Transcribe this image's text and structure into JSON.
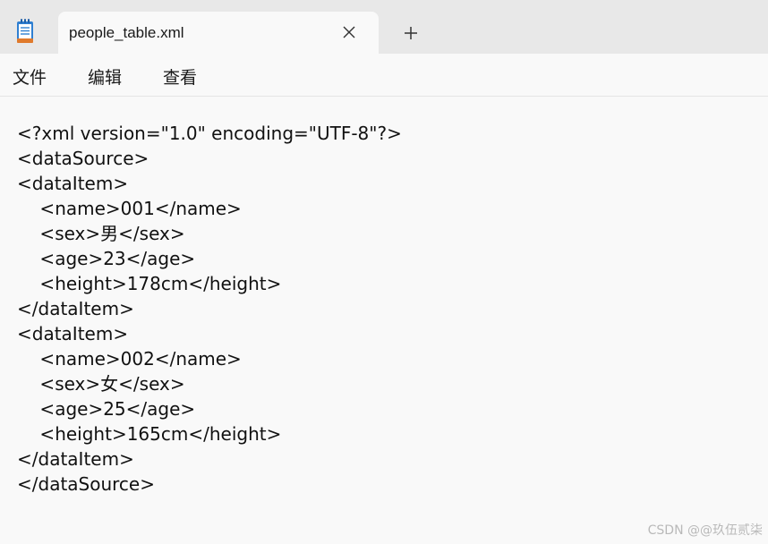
{
  "tab": {
    "title": "people_table.xml"
  },
  "menu": [
    {
      "label": "文件"
    },
    {
      "label": "编辑"
    },
    {
      "label": "查看"
    }
  ],
  "editor": {
    "lines": [
      "<?xml version=\"1.0\" encoding=\"UTF-8\"?>",
      "<dataSource>",
      "<dataItem>",
      "    <name>001</name>",
      "    <sex>男</sex>",
      "    <age>23</age>",
      "    <height>178cm</height>",
      "</dataItem>",
      "<dataItem>",
      "    <name>002</name>",
      "    <sex>女</sex>",
      "    <age>25</age>",
      "    <height>165cm</height>",
      "</dataItem>",
      "</dataSource>"
    ]
  },
  "watermark": "CSDN @@玖伍贰柒",
  "colors": {
    "titlebar": "#e8e8e8",
    "background": "#f9f9f9",
    "text": "#111111",
    "icon_blue": "#2f7fd1",
    "icon_orange": "#e07a2c"
  }
}
